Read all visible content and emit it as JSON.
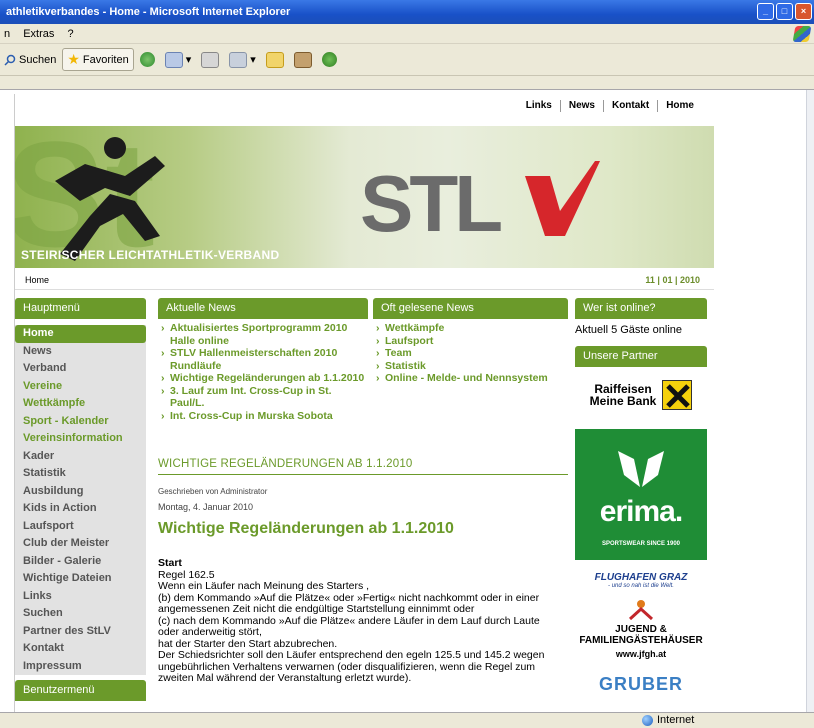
{
  "window": {
    "title": "athletikverbandes - Home - Microsoft Internet Explorer",
    "buttons": [
      "_",
      "□",
      "×"
    ]
  },
  "menubar": {
    "items": [
      "n",
      "Extras",
      "?"
    ]
  },
  "toolbar": {
    "search_label": "Suchen",
    "favorites_label": "Favoriten"
  },
  "statusbar": {
    "zone": "Internet"
  },
  "site": {
    "topnav": [
      "Links",
      "News",
      "Kontakt",
      "Home"
    ],
    "banner_caption": "STEIRISCHER LEICHTATHLETIK-VERBAND",
    "logo_text": "StLV",
    "breadcrumb": "Home",
    "date": "11 | 01 | 2010"
  },
  "sidebar": {
    "title": "Hauptmenü",
    "items": [
      {
        "label": "Home",
        "style": "active"
      },
      {
        "label": "News",
        "style": "gray"
      },
      {
        "label": "Verband",
        "style": "gray"
      },
      {
        "label": "Vereine",
        "style": "green"
      },
      {
        "label": "Wettkämpfe",
        "style": "green"
      },
      {
        "label": "Sport - Kalender",
        "style": "green"
      },
      {
        "label": "Vereinsinformation",
        "style": "green"
      },
      {
        "label": "Kader",
        "style": "gray"
      },
      {
        "label": "Statistik",
        "style": "gray"
      },
      {
        "label": "Ausbildung",
        "style": "gray"
      },
      {
        "label": "Kids in Action",
        "style": "gray"
      },
      {
        "label": "Laufsport",
        "style": "gray"
      },
      {
        "label": "Club der Meister",
        "style": "gray"
      },
      {
        "label": "Bilder - Galerie",
        "style": "gray"
      },
      {
        "label": "Wichtige Dateien",
        "style": "gray"
      },
      {
        "label": "Links",
        "style": "gray"
      },
      {
        "label": "Suchen",
        "style": "gray"
      },
      {
        "label": "Partner des StLV",
        "style": "gray"
      },
      {
        "label": "Kontakt",
        "style": "gray"
      },
      {
        "label": "Impressum",
        "style": "gray"
      }
    ],
    "user_menu_title": "Benutzermenü"
  },
  "news": {
    "title": "Aktuelle News",
    "items": [
      "Aktualisiertes Sportprogramm 2010 Halle online",
      "STLV Hallenmeisterschaften 2010 Rundläufe",
      "Wichtige Regeländerungen ab 1.1.2010",
      "3. Lauf zum Int. Cross-Cup in St. Paul/L.",
      "Int. Cross-Cup in Murska Sobota"
    ]
  },
  "popular": {
    "title": "Oft gelesene News",
    "items": [
      "Wettkämpfe",
      "Laufsport",
      "Team",
      "Statistik",
      "Online - Melde- und Nennsystem"
    ]
  },
  "article": {
    "section_heading": "WICHTIGE REGELÄNDERUNGEN AB 1.1.2010",
    "author": "Geschrieben von Administrator",
    "date": "Montag, 4. Januar 2010",
    "title": "Wichtige Regeländerungen ab 1.1.2010",
    "subheading": "Start",
    "lines": [
      "Regel 162.5",
      "Wenn ein Läufer nach Meinung des Starters ,",
      "(b) dem Kommando »Auf die Plätze« oder »Fertig« nicht nachkommt oder in einer",
      "angemessenen Zeit  nicht die endgültige Startstellung einnimmt oder",
      "(c) nach dem Kommando »Auf die Plätze« andere Läufer in dem Lauf durch Laute",
      "oder anderweitig stört,",
      "hat der Starter den Start abzubrechen.",
      "Der Schiedsrichter soll den Läufer entsprechend den egeln 125.5 und 145.2 wegen",
      "ungebührlichen Verhaltens verwarnen (oder disqualifizieren, wenn die Regel zum",
      "zweiten Mal während der Veranstaltung erletzt wurde)."
    ]
  },
  "right": {
    "online_title": "Wer ist online?",
    "online_text": "Aktuell 5 Gäste online",
    "partners_title": "Unsere Partner",
    "raiffeisen": [
      "Raiffeisen",
      "Meine Bank"
    ],
    "erima": {
      "word": "erima.",
      "tagline": "SPORTSWEAR SINCE 1900"
    },
    "flughafen": {
      "name": "FLUGHAFEN GRAZ",
      "slogan": "- und so nah ist die Welt."
    },
    "jugend": {
      "line1": "JUGEND &",
      "line2": "FAMILIENGÄSTEHÄUSER",
      "url": "www.jfgh.at"
    },
    "gruber": "GRUBER"
  },
  "colors": {
    "accent_green": "#6b9a2a",
    "menu_bg": "#e2e2e2",
    "xp_blue": "#1951c8"
  }
}
